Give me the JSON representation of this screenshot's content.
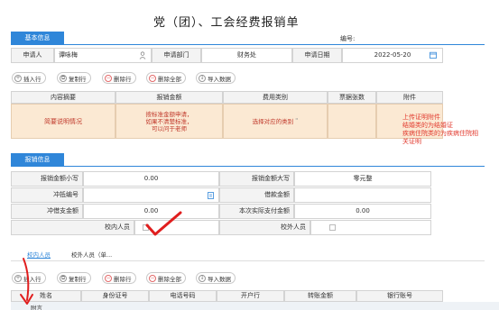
{
  "title": "党（团）、工会经费报销单",
  "serial_label": "编号:",
  "basic": {
    "tab": "基本信息",
    "applicant_label": "申请人",
    "applicant_value": "谭咏梅",
    "dept_label": "申请部门",
    "dept_value": "财务处",
    "date_label": "申请日期",
    "date_value": "2022-05-20"
  },
  "toolbar": {
    "insert": "插入行",
    "copy": "复制行",
    "delete": "删除行",
    "delete_all": "删除全部",
    "import": "导入数据"
  },
  "detail_table": {
    "headers": [
      "内容摘要",
      "报销金额",
      "费用类别",
      "票据张数",
      "附件"
    ],
    "row": {
      "summary_hint": "简要说明情况",
      "amount_hint": "按标准金额申请，\n如果不清楚标准，\n可以问于老师",
      "category_hint": "选择对应的类别",
      "category_extra": "\"",
      "attach_marker": "·"
    }
  },
  "attachment_note": [
    "上传证明附件",
    "结婚类的为结婚证",
    "疾病住院类的为疾病住院相",
    "关证明"
  ],
  "reimburse": {
    "tab": "报销信息",
    "amount_small_label": "报销金额小写",
    "amount_small_value": "0.00",
    "amount_big_label": "报销金额大写",
    "amount_big_value": "零元整",
    "offset_no_label": "冲抵编号",
    "loan_label": "借款金额",
    "offset_amount_label": "冲借支金额",
    "offset_amount_value": "0.00",
    "pay_label": "本次实际支付金额",
    "pay_value": "0.00",
    "internal_label": "校内人员",
    "external_label": "校外人员"
  },
  "people_tabs": {
    "internal": "校内人员",
    "external": "校外人员（单..."
  },
  "bottom_headers": [
    "姓名",
    "身份证号",
    "电话号码",
    "开户行",
    "转账金额",
    "银行账号"
  ],
  "bottom_row_hint": "附言",
  "colors": {
    "accent": "#2f86d9",
    "note": "#e23b2f",
    "peach": "#fbe9d3"
  }
}
